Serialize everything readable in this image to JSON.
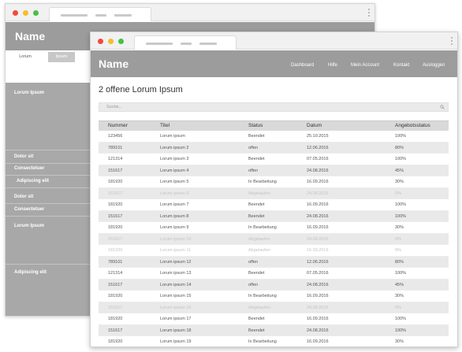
{
  "back_window": {
    "title": "Name",
    "tabs": [
      "Lorum",
      "Ipsum"
    ],
    "sidebar": [
      "Lorum Ipsum",
      "Dolor sit",
      "Consectetuer",
      "Adipiscing elit",
      "Dolor sit",
      "Consectetuer",
      "Lorum Ipsum",
      "Adipiscing elit"
    ]
  },
  "front_window": {
    "title": "Name",
    "nav": [
      "Dashboard",
      "Hilfe",
      "Mein Account",
      "Kontakt",
      "Ausloggen"
    ],
    "page_title": "2 offene Lorum Ipsum",
    "search_placeholder": "Suche...",
    "columns": [
      "Nummer",
      "Titel",
      "Status",
      "Datum",
      "Angebotsstatus"
    ],
    "rows": [
      {
        "num": "123456",
        "title": "Lorum ipsum",
        "status": "Beendet",
        "date": "25.10.2015",
        "pct": "100%",
        "muted": false
      },
      {
        "num": "789101",
        "title": "Lorum ipsum 2",
        "status": "offen",
        "date": "12.06.2016",
        "pct": "80%",
        "muted": false
      },
      {
        "num": "121314",
        "title": "Lorum ipsum 3",
        "status": "Beendet",
        "date": "07.05.2016",
        "pct": "100%",
        "muted": false
      },
      {
        "num": "151617",
        "title": "Lorum ipsum 4",
        "status": "offen",
        "date": "24.08.2016",
        "pct": "45%",
        "muted": false
      },
      {
        "num": "181920",
        "title": "Lorum ipsum 5",
        "status": "In Bearbeitung",
        "date": "16.09.2016",
        "pct": "30%",
        "muted": false
      },
      {
        "num": "151617",
        "title": "Lorum ipsum 6",
        "status": "Abgelaufen",
        "date": "24.08.2016",
        "pct": "0%",
        "muted": true
      },
      {
        "num": "181920",
        "title": "Lorum ipsum 7",
        "status": "Beendet",
        "date": "16.09.2016",
        "pct": "100%",
        "muted": false
      },
      {
        "num": "151617",
        "title": "Lorum ipsum 8",
        "status": "Beendet",
        "date": "24.08.2016",
        "pct": "100%",
        "muted": false
      },
      {
        "num": "181920",
        "title": "Lorum ipsum 9",
        "status": "In Bearbeitung",
        "date": "16.09.2016",
        "pct": "30%",
        "muted": false
      },
      {
        "num": "151617",
        "title": "Lorum ipsum 10",
        "status": "Abgelaufen",
        "date": "24.08.2016",
        "pct": "0%",
        "muted": true
      },
      {
        "num": "181920",
        "title": "Lorum ipsum 11",
        "status": "Abgelaufen",
        "date": "16.09.2016",
        "pct": "0%",
        "muted": true
      },
      {
        "num": "789101",
        "title": "Lorum ipsum 12",
        "status": "offen",
        "date": "12.06.2016",
        "pct": "80%",
        "muted": false
      },
      {
        "num": "121314",
        "title": "Lorum ipsum 13",
        "status": "Beendet",
        "date": "07.05.2016",
        "pct": "100%",
        "muted": false
      },
      {
        "num": "151617",
        "title": "Lorum ipsum 14",
        "status": "offen",
        "date": "24.08.2016",
        "pct": "45%",
        "muted": false
      },
      {
        "num": "181920",
        "title": "Lorum ipsum 15",
        "status": "In Bearbeitung",
        "date": "16.09.2016",
        "pct": "30%",
        "muted": false
      },
      {
        "num": "151617",
        "title": "Lorum ipsum 16",
        "status": "Abgelaufen",
        "date": "24.08.2016",
        "pct": "0%",
        "muted": true
      },
      {
        "num": "181920",
        "title": "Lorum ipsum 17",
        "status": "Beendet",
        "date": "16.09.2016",
        "pct": "100%",
        "muted": false
      },
      {
        "num": "151617",
        "title": "Lorum ipsum 18",
        "status": "Beendet",
        "date": "24.08.2016",
        "pct": "100%",
        "muted": false
      },
      {
        "num": "181920",
        "title": "Lorum ipsum 19",
        "status": "In Bearbeitung",
        "date": "16.09.2016",
        "pct": "30%",
        "muted": false
      }
    ]
  },
  "colors": {
    "header": "#9c9c9c",
    "sidebar": "#a8a8a8",
    "table_head": "#d9d9d9",
    "row_alt": "#e9e9e9",
    "dot_red": "#f04a3c",
    "dot_yellow": "#f5bd2a",
    "dot_green": "#45c145"
  },
  "icons": [
    "search-icon",
    "kebab-menu-icon"
  ]
}
